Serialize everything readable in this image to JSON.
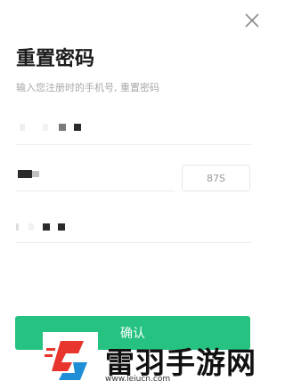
{
  "header": {
    "title": "重置密码",
    "subtitle": "输入您注册时的手机号, 重置密码"
  },
  "close_icon": "close-icon",
  "form": {
    "phone": {
      "value_display": "masked"
    },
    "code": {
      "value_display": "masked",
      "countdown_label": "87S"
    },
    "password": {
      "value_display": "masked"
    }
  },
  "confirm_button": {
    "label": "确认",
    "color": "#26c281"
  },
  "watermark": {
    "brand": "雷羽手游网",
    "url": "www.leiucn.com",
    "colors": {
      "red": "#e8352d",
      "blue": "#1e8fd6"
    }
  }
}
